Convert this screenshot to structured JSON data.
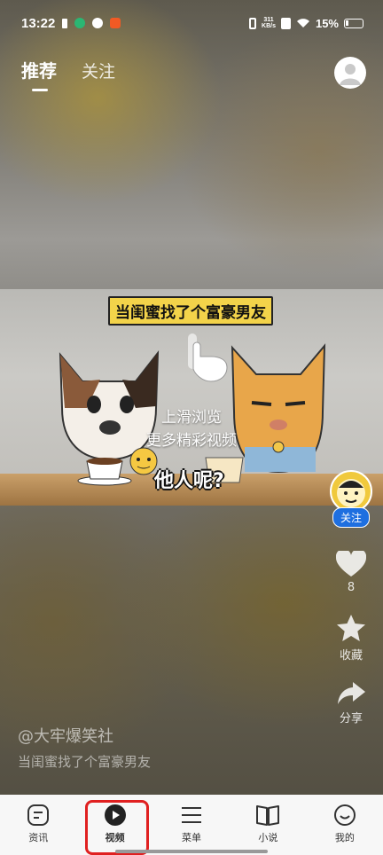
{
  "status_bar": {
    "time": "13:22",
    "net_speed_value": "311",
    "net_speed_unit": "KB/s",
    "battery": "15%"
  },
  "top_tabs": [
    {
      "label": "推荐",
      "active": true
    },
    {
      "label": "关注",
      "active": false
    }
  ],
  "video": {
    "top_caption": "当闺蜜找了个富豪男友",
    "bottom_caption": "他人呢?",
    "swipe_hint_line1": "上滑浏览",
    "swipe_hint_line2": "更多精彩视频"
  },
  "rail": {
    "follow_label": "关注",
    "like_count": "8",
    "favorite_label": "收藏",
    "share_label": "分享"
  },
  "info": {
    "author": "@大牢爆笑社",
    "title": "当闺蜜找了个富豪男友"
  },
  "bottom_nav": [
    {
      "label": "资讯",
      "icon": "news-icon"
    },
    {
      "label": "视频",
      "icon": "video-play-icon",
      "active": true
    },
    {
      "label": "菜单",
      "icon": "menu-icon"
    },
    {
      "label": "小说",
      "icon": "book-icon"
    },
    {
      "label": "我的",
      "icon": "profile-smile-icon"
    }
  ],
  "colors": {
    "follow_button": "#1e6fe0",
    "highlight_box": "#e02020",
    "caption_bg": "#f3d34a"
  }
}
